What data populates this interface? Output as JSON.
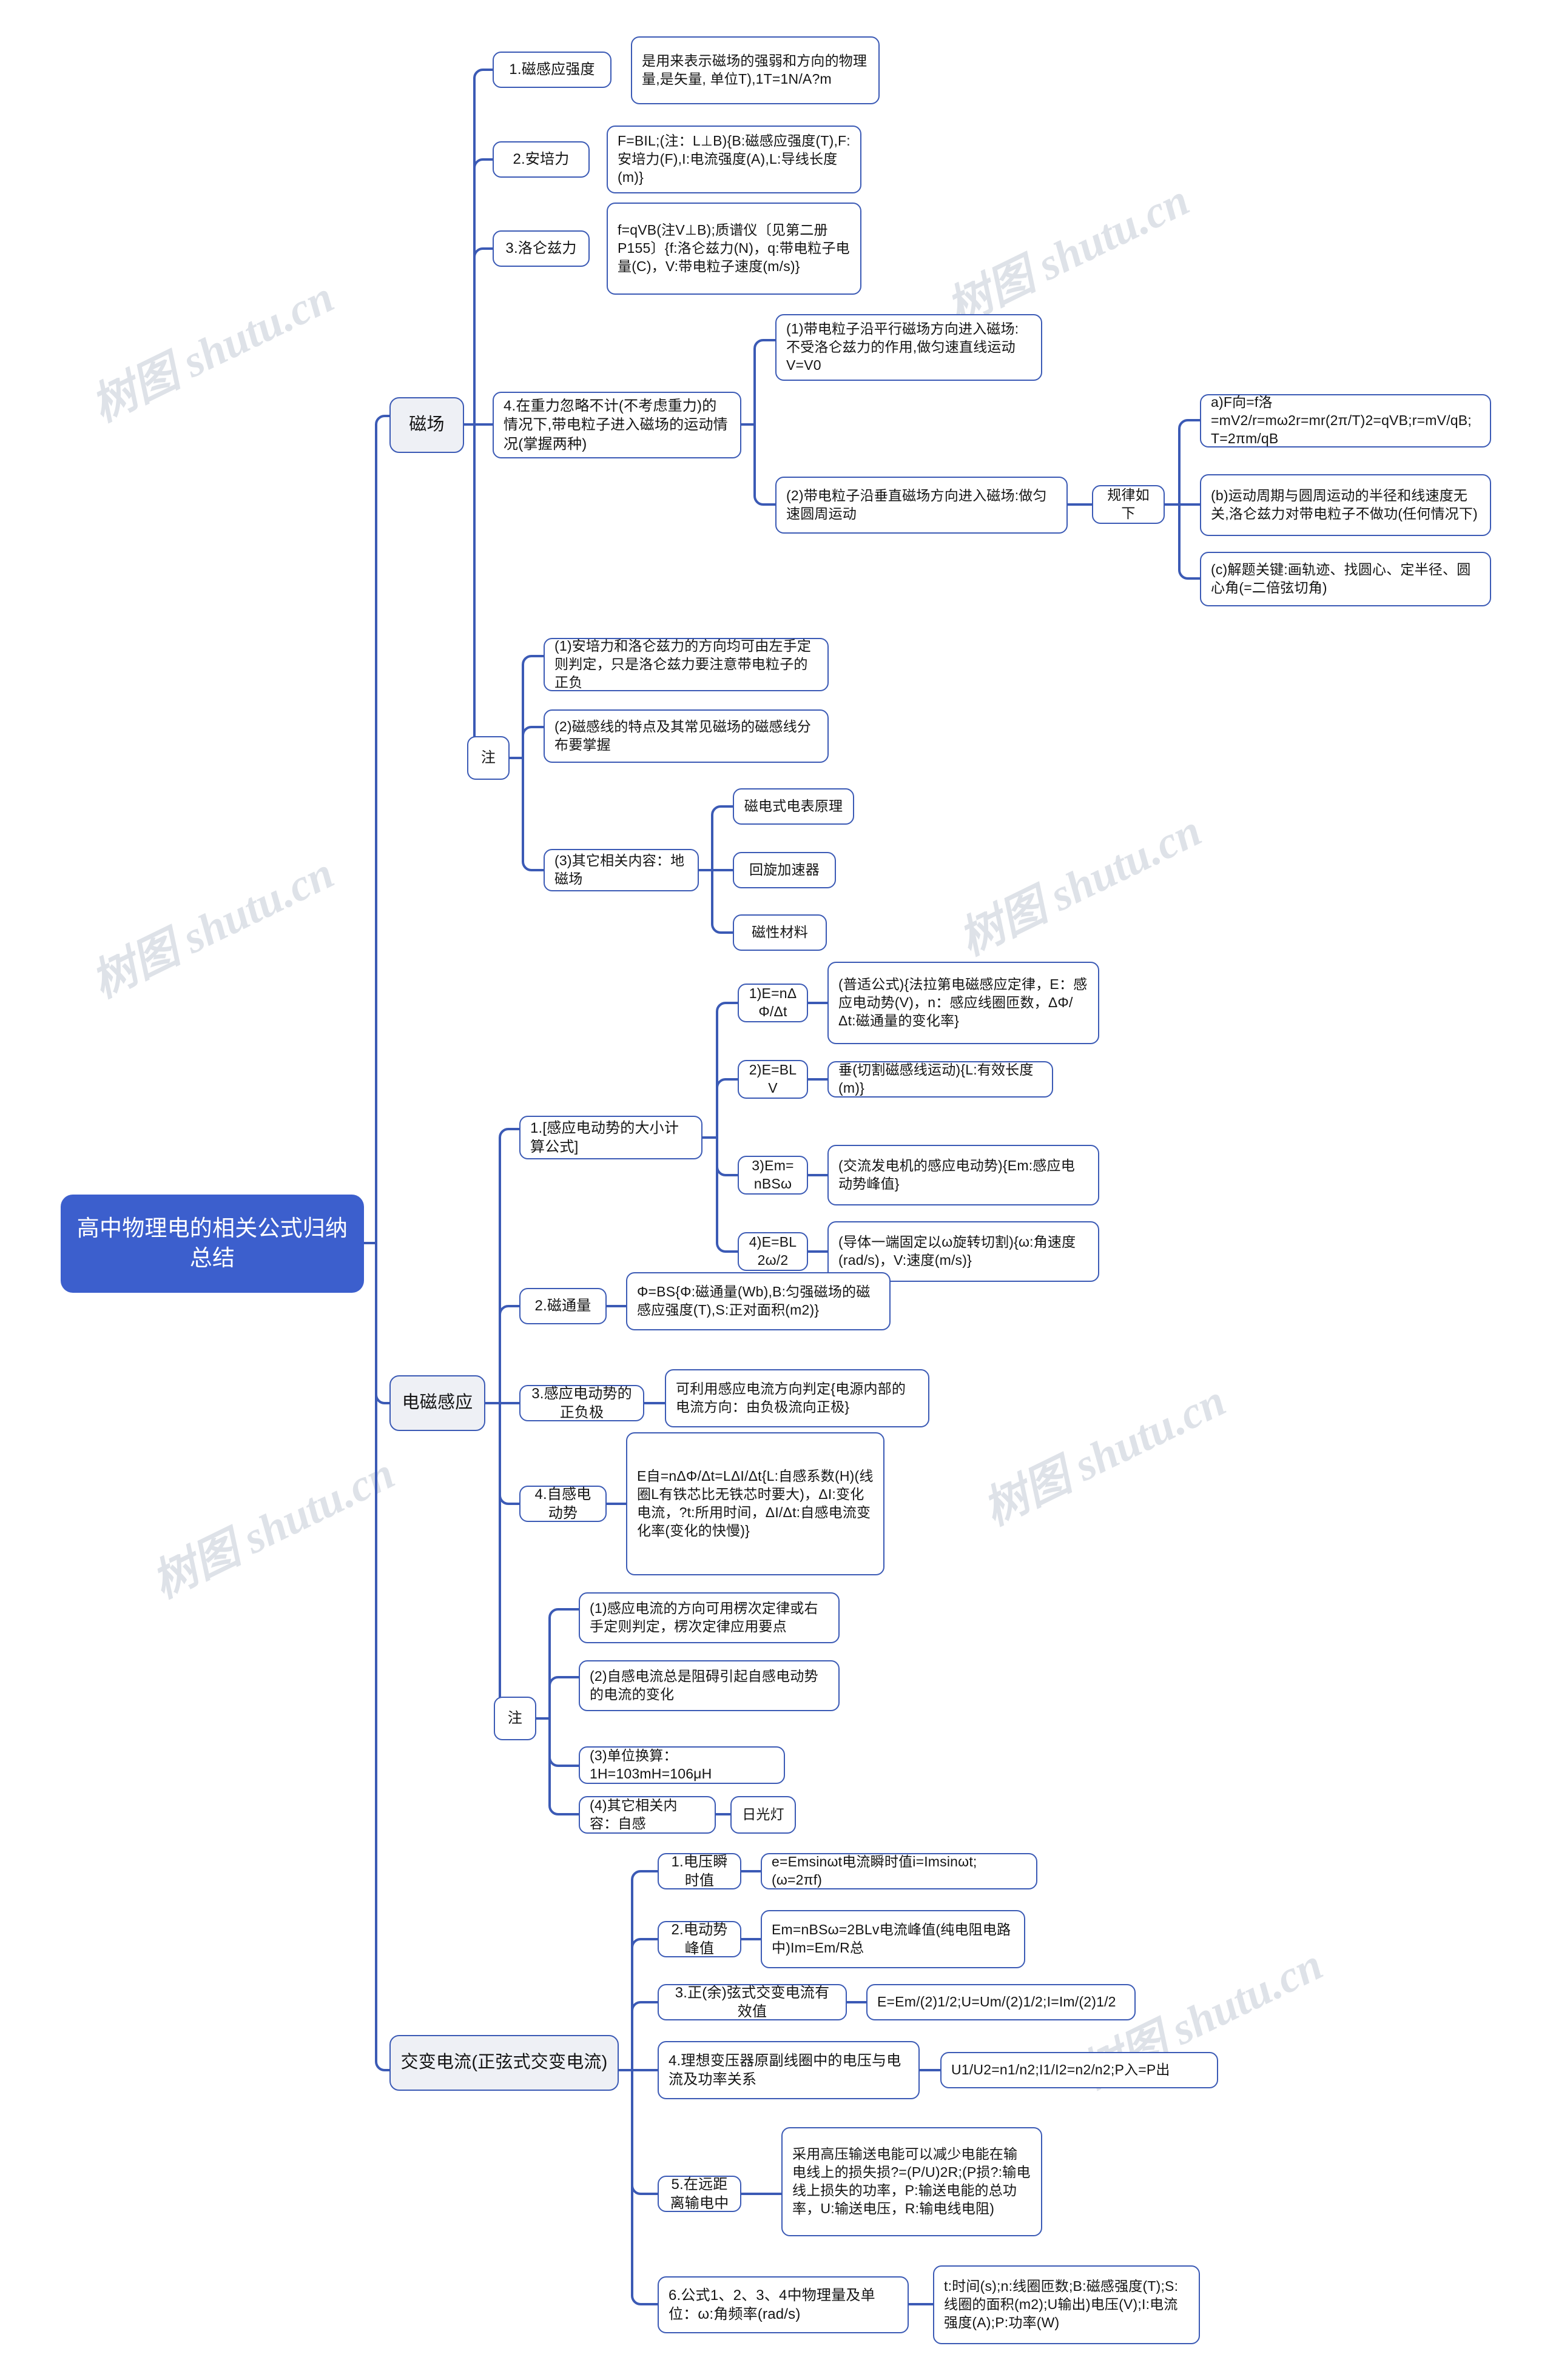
{
  "root": {
    "title": "高中物理电的相关公式归纳总结"
  },
  "watermark": {
    "text": "树图 shutu.cn"
  },
  "colors": {
    "root_fill": "#3c5fcd",
    "root_text": "#ffffff",
    "branch_fill": "#eef0f5",
    "node_border": "#3b5ab5",
    "link": "#3b5ab5",
    "node_text": "#141414",
    "watermark": "#d9dde4"
  },
  "branches": [
    {
      "id": "magnetic-field",
      "label": "磁场",
      "items": [
        {
          "label": "1.磁感应强度",
          "detail": "是用来表示磁场的强弱和方向的物理量,是矢量, 单位T),1T=1N/A?m"
        },
        {
          "label": "2.安培力",
          "detail": "F=BIL;(注：L⊥B){B:磁感应强度(T),F:安培力(F),I:电流强度(A),L:导线长度(m)}"
        },
        {
          "label": "3.洛仑兹力",
          "detail": "f=qVB(注V⊥B);质谱仪〔见第二册P155〕{f:洛仑兹力(N)，q:带电粒子电量(C)，V:带电粒子速度(m/s)}"
        },
        {
          "label": "4.在重力忽略不计(不考虑重力)的情况下,带电粒子进入磁场的运动情况(掌握两种)",
          "cases": [
            {
              "text": "(1)带电粒子沿平行磁场方向进入磁场:不受洛仑兹力的作用,做匀速直线运动V=V0"
            },
            {
              "text": "(2)带电粒子沿垂直磁场方向进入磁场:做匀速圆周运动",
              "rule_label": "规律如下",
              "rules": [
                "a)F向=f洛=mV2/r=mω2r=mr(2π/T)2=qVB;r=mV/qB;T=2πm/qB",
                "(b)运动周期与圆周运动的半径和线速度无关,洛仑兹力对带电粒子不做功(任何情况下)",
                "(c)解题关键:画轨迹、找圆心、定半径、圆心角(=二倍弦切角)"
              ]
            }
          ]
        }
      ],
      "note": {
        "label": "注",
        "items": [
          {
            "text": "(1)安培力和洛仑兹力的方向均可由左手定则判定，只是洛仑兹力要注意带电粒子的正负"
          },
          {
            "text": "(2)磁感线的特点及其常见磁场的磁感线分布要掌握"
          },
          {
            "text": "(3)其它相关内容：地磁场",
            "children": [
              "磁电式电表原理",
              "回旋加速器",
              "磁性材料"
            ]
          }
        ]
      }
    },
    {
      "id": "electromagnetic-induction",
      "label": "电磁感应",
      "items": [
        {
          "label": "1.[感应电动势的大小计算公式]",
          "formulas": [
            {
              "name": "1)E=nΔΦ/Δt",
              "detail": "(普适公式){法拉第电磁感应定律，E：感应电动势(V)，n：感应线圈匝数，ΔΦ/Δt:磁通量的变化率}"
            },
            {
              "name": "2)E=BLV",
              "detail": "垂(切割磁感线运动){L:有效长度(m)}"
            },
            {
              "name": "3)Em=nBSω",
              "detail": "(交流发电机的感应电动势){Em:感应电动势峰值}"
            },
            {
              "name": "4)E=BL2ω/2",
              "detail": "(导体一端固定以ω旋转切割){ω:角速度(rad/s)，V:速度(m/s)}"
            }
          ]
        },
        {
          "label": "2.磁通量",
          "detail": "Φ=BS{Φ:磁通量(Wb),B:匀强磁场的磁感应强度(T),S:正对面积(m2)}"
        },
        {
          "label": "3.感应电动势的正负极",
          "detail": "可利用感应电流方向判定{电源内部的电流方向：由负极流向正极}"
        },
        {
          "label": "4.自感电动势",
          "detail": "E自=nΔΦ/Δt=LΔI/Δt{L:自感系数(H)(线圈L有铁芯比无铁芯时要大)，ΔI:变化电流，?t:所用时间，ΔI/Δt:自感电流变化率(变化的快慢)}"
        }
      ],
      "note": {
        "label": "注",
        "items": [
          {
            "text": "(1)感应电流的方向可用楞次定律或右手定则判定，楞次定律应用要点"
          },
          {
            "text": "(2)自感电流总是阻碍引起自感电动势的电流的变化"
          },
          {
            "text": "(3)单位换算：1H=103mH=106μH"
          },
          {
            "text": "(4)其它相关内容：自感",
            "children": [
              "日光灯"
            ]
          }
        ]
      }
    },
    {
      "id": "alternating-current",
      "label": "交变电流(正弦式交变电流)",
      "items": [
        {
          "label": "1.电压瞬时值",
          "detail": "e=Emsinωt电流瞬时值i=Imsinωt;(ω=2πf)"
        },
        {
          "label": "2.电动势峰值",
          "detail": "Em=nBSω=2BLv电流峰值(纯电阻电路中)Im=Em/R总"
        },
        {
          "label": "3.正(余)弦式交变电流有效值",
          "detail": "E=Em/(2)1/2;U=Um/(2)1/2;I=Im/(2)1/2"
        },
        {
          "label": "4.理想变压器原副线圈中的电压与电流及功率关系",
          "detail": "U1/U2=n1/n2;I1/I2=n2/n2;P入=P出"
        },
        {
          "label": "5.在远距离输电中",
          "detail": "采用高压输送电能可以减少电能在输电线上的损失损?=(P/U)2R;(P损?:输电线上损失的功率，P:输送电能的总功率，U:输送电压，R:输电线电阻)"
        },
        {
          "label": "6.公式1、2、3、4中物理量及单位：ω:角频率(rad/s)",
          "detail": "t:时间(s);n:线圈匝数;B:磁感强度(T);S:线圈的面积(m2);U输出)电压(V);I:电流强度(A);P:功率(W)"
        }
      ]
    }
  ]
}
